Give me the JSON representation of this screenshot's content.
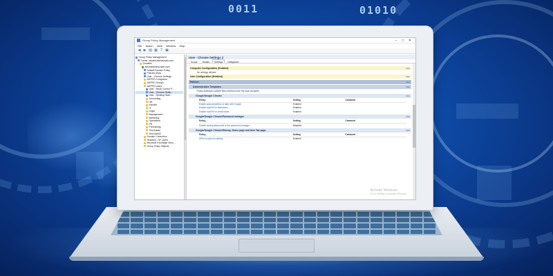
{
  "colors": {
    "background_blue": "#0f4fae",
    "header_yellow": "#fdf4c9",
    "policies_bar": "#aebfd6",
    "link_blue": "#2a5ec0"
  },
  "background": {
    "binary_left": "0011",
    "binary_right": "01010"
  },
  "window": {
    "title": "Group Policy Management",
    "controls": [
      "–",
      "□",
      "✕"
    ],
    "menu": [
      "File",
      "Action",
      "View",
      "Window",
      "Help"
    ],
    "toolbar_icons": [
      "back-icon",
      "forward-icon",
      "folder-icon",
      "properties-icon",
      "help-icon",
      "details-icon"
    ]
  },
  "tree": {
    "items": [
      {
        "label": "Group Policy Management",
        "icon": "gpo",
        "depth": 0
      },
      {
        "label": "Forest: adcahindwinscripts.com",
        "icon": "forest",
        "depth": 1
      },
      {
        "label": "Domains",
        "icon": "folder",
        "depth": 2
      },
      {
        "label": "adcahindwinscripts.com",
        "icon": "domain",
        "depth": 3
      },
      {
        "label": "Default Domain Policy",
        "icon": "gpo",
        "depth": 4
      },
      {
        "label": "Policies Allow",
        "icon": "gpo",
        "depth": 4
      },
      {
        "label": "User - Chrome Settings",
        "icon": "gpo",
        "depth": 4
      },
      {
        "label": "ADPRO Computers",
        "icon": "folder",
        "depth": 4
      },
      {
        "label": "ADPRO Groups",
        "icon": "folder",
        "depth": 4
      },
      {
        "label": "ADPRO Users",
        "icon": "folder",
        "depth": 4
      },
      {
        "label": "User - Block Control P...",
        "icon": "gpo",
        "depth": 5
      },
      {
        "label": "User - Chrome Settin...",
        "icon": "gpo",
        "depth": 5,
        "selected": true
      },
      {
        "label": "User - Desktop Wall...",
        "icon": "gpo",
        "depth": 5
      },
      {
        "label": "Accounting",
        "icon": "folder",
        "depth": 5
      },
      {
        "label": "HR",
        "icon": "folder",
        "depth": 5
      },
      {
        "label": "Inactive",
        "icon": "folder",
        "depth": 5
      },
      {
        "label": "IT",
        "icon": "folder",
        "depth": 5
      },
      {
        "label": "Legal",
        "icon": "folder",
        "depth": 5
      },
      {
        "label": "Management",
        "icon": "folder",
        "depth": 5
      },
      {
        "label": "Marketing",
        "icon": "folder",
        "depth": 5
      },
      {
        "label": "Operations",
        "icon": "folder",
        "depth": 5
      },
      {
        "label": "PR",
        "icon": "folder",
        "depth": 5
      },
      {
        "label": "Purchasing",
        "icon": "folder",
        "depth": 5
      },
      {
        "label": "Test Admin",
        "icon": "folder",
        "depth": 5
      },
      {
        "label": "Test Acct02",
        "icon": "folder",
        "depth": 5
      },
      {
        "label": "Domain Controllers",
        "icon": "folder",
        "depth": 4
      },
      {
        "label": "Resident - SF Users",
        "icon": "folder",
        "depth": 4
      },
      {
        "label": "Microsoft Exchange Secu...",
        "icon": "folder",
        "depth": 4
      },
      {
        "label": "Group Policy Objects",
        "icon": "folder",
        "depth": 4
      }
    ]
  },
  "detail": {
    "header": "User - Chrome Settings 3",
    "tabs": [
      "Scope",
      "Details",
      "Settings",
      "Delegation"
    ],
    "active_tab": "Settings",
    "hide_label": "hide",
    "computer_config": "Computer Configuration (Enabled)",
    "no_settings": "No settings defined.",
    "user_config": "User Configuration (Enabled)",
    "policies": "Policies",
    "admin_templates": "Administrative Templates",
    "admin_note": "Policy definitions (ADMX files) retrieved from the local computer.",
    "table_headers": [
      "Policy",
      "Setting",
      "Comment"
    ],
    "sections": [
      {
        "title": "Google/Google Chrome",
        "rows": [
          [
            "Enable autocompletion of date with Google",
            "Enabled",
            ""
          ],
          [
            "Enable AutoFill for addresses",
            "Enabled",
            ""
          ],
          [
            "Enable AutoFill for credit cards",
            "Enabled",
            ""
          ]
        ]
      },
      {
        "title": "Google/Google Chrome/Password manager",
        "rows": [
          [
            "Enable saving passwords to the password manager",
            "Disabled",
            ""
          ]
        ]
      },
      {
        "title": "Google/Google Chrome/Startup, Home page and New Tab page",
        "rows": [
          [
            "URLs to open on startup",
            "Enabled",
            ""
          ]
        ]
      }
    ],
    "watermark_title": "Activate Windows",
    "watermark_sub": "Go to Settings to activate Windows."
  }
}
